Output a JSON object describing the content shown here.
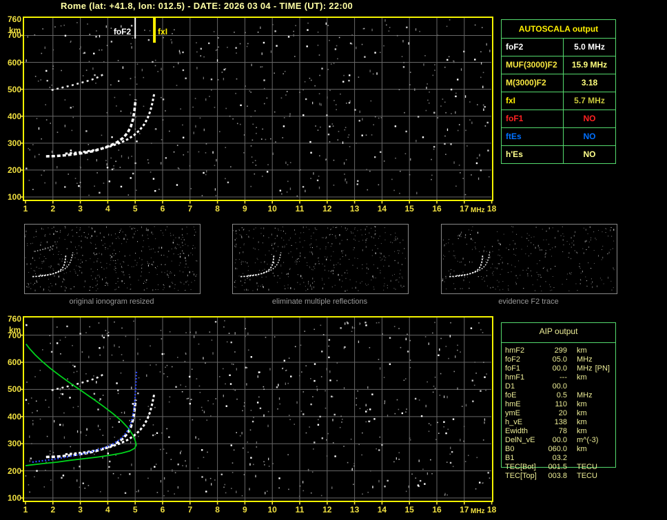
{
  "title": "Rome (lat: +41.8, lon: 012.5) - DATE: 2026 03 04 - TIME (UT): 22:00",
  "colors": {
    "background": "#000000",
    "title_text": "#FFFFA4",
    "axis_text": "#F0E040",
    "plot_border": "#F4F400",
    "grid": "#686868",
    "table_border": "#55DB6E",
    "profile_green": "#00D41C",
    "restored_blue": "#2E4BFF",
    "trace_white": "#FFFFFF",
    "aip_text": "#ECEC96"
  },
  "autoscala_table": {
    "header": "AUTOSCALA output",
    "rows": [
      {
        "label": "foF2",
        "value": "5.0 MHz",
        "label_color": "#FFFFFF",
        "value_color": "#FFFFFF"
      },
      {
        "label": "MUF(3000)F2",
        "value": "15.9 MHz",
        "label_color": "#F8E840",
        "value_color": "#FFFF7E"
      },
      {
        "label": "M(3000)F2",
        "value": "3.18",
        "label_color": "#F8E840",
        "value_color": "#FFFF7E"
      },
      {
        "label": "fxI",
        "value": "5.7 MHz",
        "label_color": "#FFF000",
        "value_color": "#C8C83C"
      },
      {
        "label": "foF1",
        "value": "NO",
        "label_color": "#FF2222",
        "value_color": "#FF2222"
      },
      {
        "label": "ftEs",
        "value": "NO",
        "label_color": "#0070FF",
        "value_color": "#0070FF"
      },
      {
        "label": "h'Es",
        "value": "NO",
        "label_color": "#FFFF8C",
        "value_color": "#FFFF8C"
      }
    ]
  },
  "aip_table": {
    "header": "AIP output",
    "rows": [
      {
        "label": "hmF2",
        "value": "299",
        "unit": "km",
        "note": ""
      },
      {
        "label": "foF2",
        "value": "05.0",
        "unit": "MHz",
        "note": ""
      },
      {
        "label": "foF1",
        "value": "00.0",
        "unit": "MHz",
        "note": "[PN]"
      },
      {
        "label": "hmF1",
        "value": "---",
        "unit": "km",
        "note": ""
      },
      {
        "label": "D1",
        "value": "00.0",
        "unit": "",
        "note": ""
      },
      {
        "label": "foE",
        "value": "0.5",
        "unit": "MHz",
        "note": ""
      },
      {
        "label": "hmE",
        "value": "110",
        "unit": "km",
        "note": ""
      },
      {
        "label": "ymE",
        "value": "20",
        "unit": "km",
        "note": ""
      },
      {
        "label": "h_vE",
        "value": "138",
        "unit": "km",
        "note": ""
      },
      {
        "label": "Ewidth",
        "value": "78",
        "unit": "km",
        "note": ""
      },
      {
        "label": "DelN_vE",
        "value": "00.0",
        "unit": "m^(-3)",
        "note": ""
      },
      {
        "label": "B0",
        "value": "060.0",
        "unit": "km",
        "note": ""
      },
      {
        "label": "B1",
        "value": "03.2",
        "unit": "",
        "note": ""
      },
      {
        "label": "TEC[Bot]",
        "value": "001.5",
        "unit": "TECU",
        "note": ""
      },
      {
        "label": "TEC[Top]",
        "value": "003.8",
        "unit": "TECU",
        "note": ""
      }
    ]
  },
  "panels": [
    {
      "label": "original ionogram resized"
    },
    {
      "label": "eliminate multiple reflections"
    },
    {
      "label": "evidence F2 trace"
    }
  ],
  "chart_data": {
    "type": "scatter",
    "description": "Vertical-incidence ionogram (top), processed mini-ionograms (middle), and autoscaled ionogram with electron-density profile (bottom)",
    "x_axis": {
      "label": "MHz",
      "min": 1,
      "max": 18,
      "ticks": [
        "1",
        "2",
        "3",
        "4",
        "5",
        "6",
        "7",
        "8",
        "9",
        "10",
        "11",
        "12",
        "13",
        "14",
        "15",
        "16",
        "17",
        "18"
      ]
    },
    "y_axis": {
      "label": "km",
      "min": 100,
      "max": 760,
      "ticks": [
        "760",
        "700",
        "600",
        "500",
        "400",
        "300",
        "200",
        "100"
      ]
    },
    "grid": true,
    "markers": [
      {
        "name": "foF2",
        "freq_mhz": 5.0,
        "color": "#FFFFFF"
      },
      {
        "name": "fxI",
        "freq_mhz": 5.7,
        "color": "#FFF000"
      }
    ],
    "traces": {
      "f2_ordinary": [
        [
          1.75,
          251
        ],
        [
          2.1,
          252
        ],
        [
          2.45,
          255
        ],
        [
          2.8,
          259
        ],
        [
          3.15,
          264
        ],
        [
          3.5,
          271
        ],
        [
          3.8,
          280
        ],
        [
          4.1,
          291
        ],
        [
          4.35,
          304
        ],
        [
          4.55,
          319
        ],
        [
          4.72,
          338
        ],
        [
          4.84,
          361
        ],
        [
          4.92,
          388
        ],
        [
          4.97,
          418
        ],
        [
          5.0,
          448
        ],
        [
          5.02,
          462
        ]
      ],
      "f2_extraordinary": [
        [
          2.45,
          261
        ],
        [
          2.8,
          264
        ],
        [
          3.15,
          268
        ],
        [
          3.5,
          274
        ],
        [
          3.85,
          281
        ],
        [
          4.15,
          290
        ],
        [
          4.45,
          301
        ],
        [
          4.72,
          314
        ],
        [
          4.95,
          329
        ],
        [
          5.15,
          347
        ],
        [
          5.32,
          368
        ],
        [
          5.45,
          392
        ],
        [
          5.55,
          419
        ],
        [
          5.62,
          447
        ],
        [
          5.67,
          472
        ],
        [
          5.7,
          487
        ]
      ],
      "multiple_reflection": [
        [
          1.95,
          497
        ],
        [
          2.2,
          503
        ],
        [
          2.45,
          509
        ],
        [
          2.7,
          515
        ],
        [
          2.95,
          522
        ],
        [
          3.2,
          529
        ],
        [
          3.45,
          537
        ],
        [
          3.65,
          545
        ],
        [
          3.8,
          553
        ],
        [
          3.9,
          560
        ]
      ],
      "profile_green": [
        [
          1.02,
          667
        ],
        [
          1.15,
          650
        ],
        [
          1.35,
          628
        ],
        [
          1.6,
          604
        ],
        [
          1.9,
          578
        ],
        [
          2.25,
          551
        ],
        [
          2.65,
          522
        ],
        [
          3.05,
          494
        ],
        [
          3.45,
          466
        ],
        [
          3.85,
          437
        ],
        [
          4.2,
          410
        ],
        [
          4.5,
          384
        ],
        [
          4.75,
          357
        ],
        [
          4.92,
          331
        ],
        [
          5.01,
          308
        ],
        [
          5.04,
          295
        ],
        [
          4.98,
          283
        ],
        [
          4.8,
          273
        ],
        [
          4.5,
          265
        ],
        [
          4.1,
          258
        ],
        [
          3.65,
          251
        ],
        [
          3.15,
          245
        ],
        [
          2.65,
          239
        ],
        [
          2.15,
          232
        ],
        [
          1.65,
          227
        ],
        [
          1.15,
          221
        ],
        [
          1.0,
          219
        ]
      ],
      "restored_trace_blue": [
        [
          1.25,
          232
        ],
        [
          1.55,
          236
        ],
        [
          1.85,
          240
        ],
        [
          2.15,
          245
        ],
        [
          2.45,
          250
        ],
        [
          2.75,
          256
        ],
        [
          3.05,
          262
        ],
        [
          3.35,
          269
        ],
        [
          3.65,
          278
        ],
        [
          3.95,
          288
        ],
        [
          4.2,
          300
        ],
        [
          4.42,
          314
        ],
        [
          4.6,
          331
        ],
        [
          4.74,
          351
        ],
        [
          4.84,
          374
        ],
        [
          4.91,
          400
        ],
        [
          4.96,
          430
        ],
        [
          4.99,
          462
        ],
        [
          5.01,
          495
        ],
        [
          5.03,
          528
        ],
        [
          5.04,
          556
        ],
        [
          5.05,
          572
        ]
      ]
    }
  }
}
